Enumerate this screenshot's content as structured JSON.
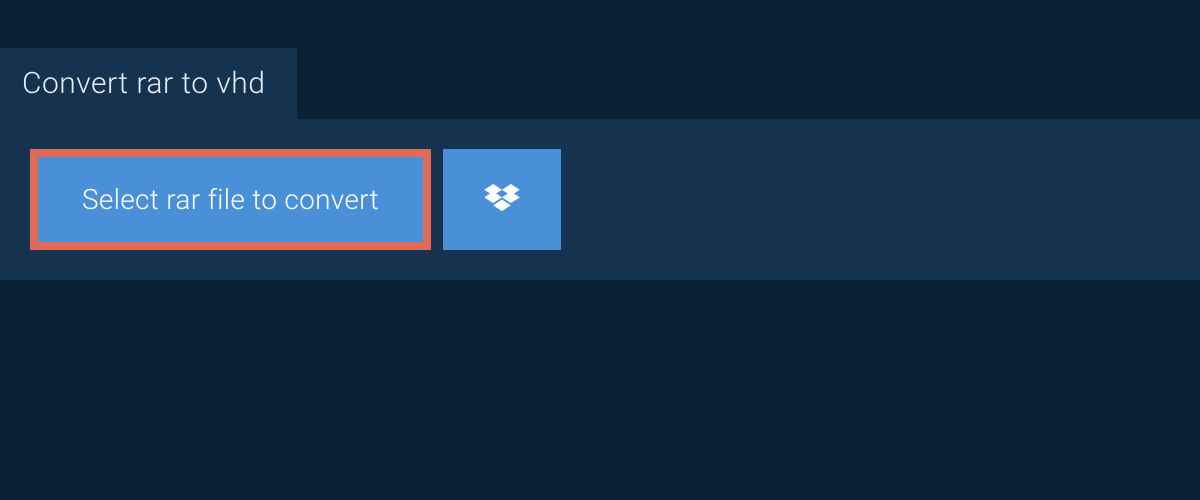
{
  "tab": {
    "title": "Convert rar to vhd"
  },
  "actions": {
    "select_file_label": "Select rar file to convert"
  },
  "colors": {
    "background": "#0d2136",
    "panel": "#15324e",
    "button": "#4a90d9",
    "highlight_border": "#e06a5a"
  }
}
